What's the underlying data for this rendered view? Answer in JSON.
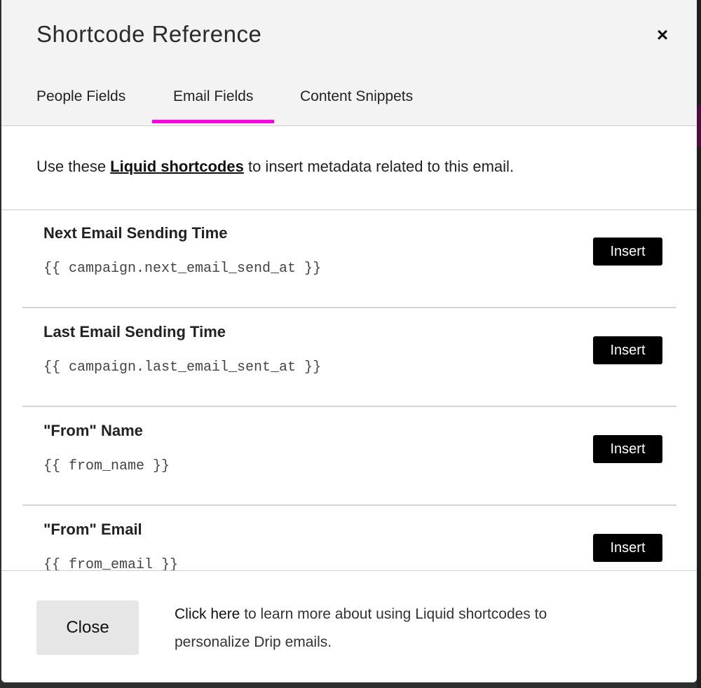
{
  "modal": {
    "title": "Shortcode Reference",
    "close_icon": "×",
    "tabs": [
      {
        "label": "People Fields",
        "active": false
      },
      {
        "label": "Email Fields",
        "active": true
      },
      {
        "label": "Content Snippets",
        "active": false
      }
    ],
    "accent_color": "#ff00e6",
    "intro": {
      "before": "Use these ",
      "link": "Liquid shortcodes",
      "after": " to insert metadata related to this email."
    },
    "items": [
      {
        "title": "Next Email Sending Time",
        "code": "{{ campaign.next_email_send_at }}",
        "button": "Insert"
      },
      {
        "title": "Last Email Sending Time",
        "code": "{{ campaign.last_email_sent_at }}",
        "button": "Insert"
      },
      {
        "title": "\"From\" Name",
        "code": "{{ from_name }}",
        "button": "Insert"
      },
      {
        "title": "\"From\" Email",
        "code": "{{ from_email }}",
        "button": "Insert"
      }
    ],
    "footer": {
      "close_label": "Close",
      "link": "Click here",
      "text": " to learn more about using Liquid shortcodes to personalize Drip emails."
    }
  }
}
